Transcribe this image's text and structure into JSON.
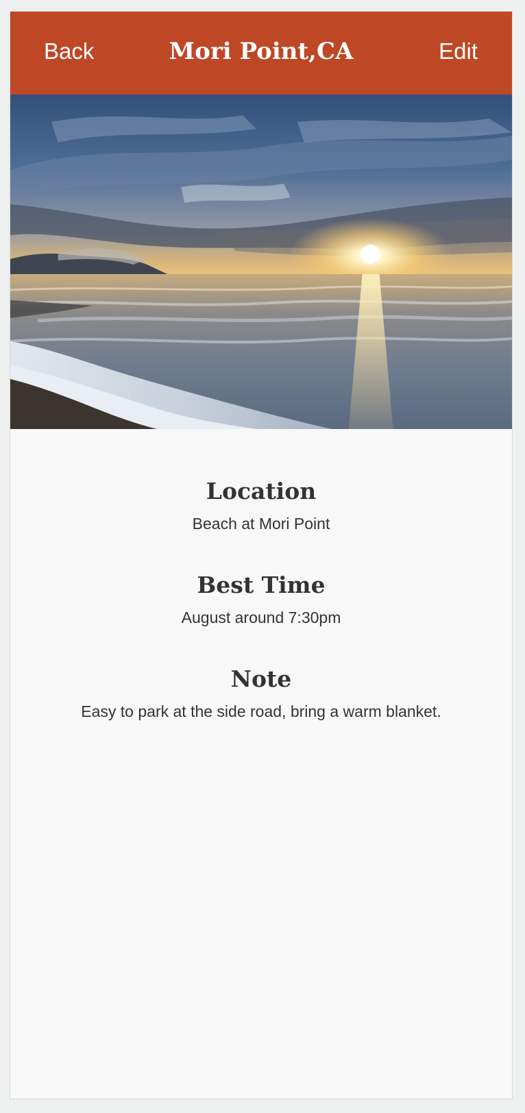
{
  "header": {
    "back_label": "Back",
    "title": "Mori Point,CA",
    "edit_label": "Edit",
    "background_color": "#be4725"
  },
  "hero_image": {
    "subject": "sunset over ocean beach with waves and clouds"
  },
  "details": {
    "location": {
      "heading": "Location",
      "value": "Beach at Mori Point"
    },
    "best_time": {
      "heading": "Best Time",
      "value": "August around 7:30pm"
    },
    "note": {
      "heading": "Note",
      "value": "Easy to park at the side road, bring a warm blanket."
    }
  }
}
